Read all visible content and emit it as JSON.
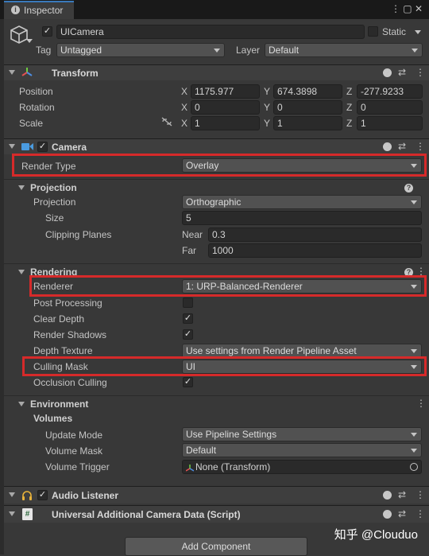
{
  "window": {
    "tab_title": "Inspector",
    "tab_icons": "⋮ ▢ ✕"
  },
  "object": {
    "name": "UICamera",
    "static_label": "Static",
    "tag_label": "Tag",
    "tag_value": "Untagged",
    "layer_label": "Layer",
    "layer_value": "Default"
  },
  "transform": {
    "title": "Transform",
    "position_label": "Position",
    "rotation_label": "Rotation",
    "scale_label": "Scale",
    "axes": [
      "X",
      "Y",
      "Z"
    ],
    "position": [
      "1175.977",
      "674.3898",
      "-277.9233"
    ],
    "rotation": [
      "0",
      "0",
      "0"
    ],
    "scale": [
      "1",
      "1",
      "1"
    ]
  },
  "camera": {
    "title": "Camera",
    "render_type_label": "Render Type",
    "render_type_value": "Overlay",
    "projection_section": "Projection",
    "projection_label": "Projection",
    "projection_value": "Orthographic",
    "size_label": "Size",
    "size_value": "5",
    "clipping_label": "Clipping Planes",
    "near_label": "Near",
    "near_value": "0.3",
    "far_label": "Far",
    "far_value": "1000",
    "rendering_section": "Rendering",
    "renderer_label": "Renderer",
    "renderer_value": "1: URP-Balanced-Renderer",
    "post_processing_label": "Post Processing",
    "clear_depth_label": "Clear Depth",
    "render_shadows_label": "Render Shadows",
    "depth_texture_label": "Depth Texture",
    "depth_texture_value": "Use settings from Render Pipeline Asset",
    "culling_mask_label": "Culling Mask",
    "culling_mask_value": "UI",
    "occlusion_label": "Occlusion Culling",
    "environment_section": "Environment",
    "volumes_label": "Volumes",
    "update_mode_label": "Update Mode",
    "update_mode_value": "Use Pipeline Settings",
    "volume_mask_label": "Volume Mask",
    "volume_mask_value": "Default",
    "volume_trigger_label": "Volume Trigger",
    "volume_trigger_value": "None (Transform)"
  },
  "audio_listener": {
    "title": "Audio Listener"
  },
  "urp_data": {
    "title": "Universal Additional Camera Data (Script)"
  },
  "add_component_label": "Add Component",
  "watermark": "知乎 @Clouduo",
  "checks": {
    "mark": "✓"
  },
  "icons": {
    "help": "?",
    "settings": "⇄",
    "more": "⋮"
  },
  "colors": {
    "highlight": "#d62a2a",
    "accent": "#3a79bb"
  }
}
